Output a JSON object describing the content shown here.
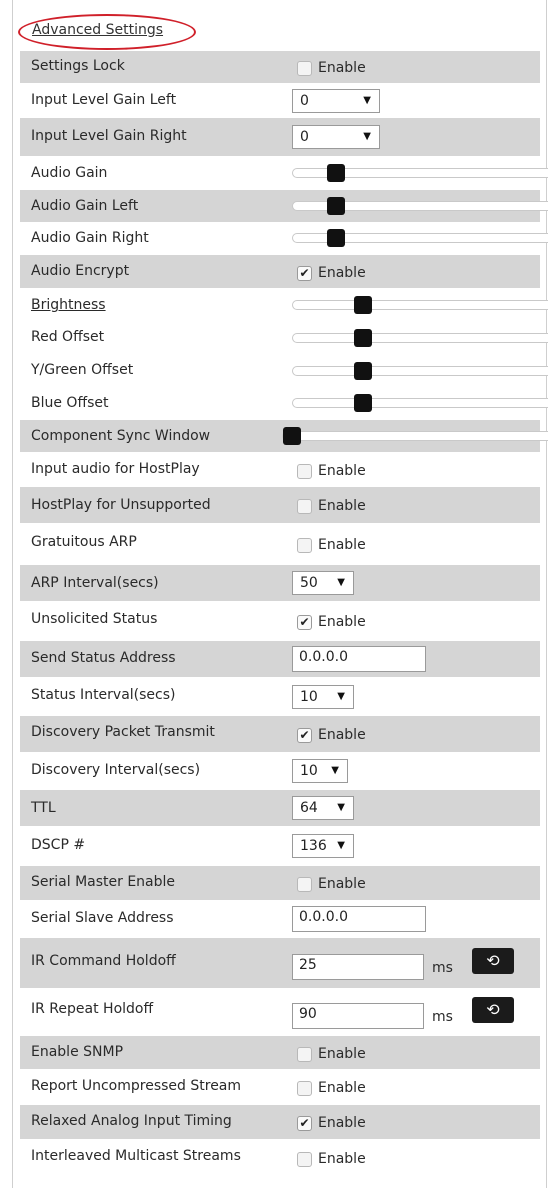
{
  "header": {
    "title": "Advanced Settings"
  },
  "labels": {
    "settings_lock": "Settings Lock",
    "input_gain_left": "Input Level Gain Left",
    "input_gain_right": "Input Level Gain Right",
    "audio_gain": "Audio Gain",
    "audio_gain_left": "Audio Gain Left",
    "audio_gain_right": "Audio Gain Right",
    "audio_encrypt": "Audio Encrypt",
    "brightness": "Brightness",
    "red_offset": "Red Offset",
    "green_offset": "Y/Green Offset",
    "blue_offset": "Blue Offset",
    "component_sync": "Component Sync Window",
    "input_audio_hostplay": "Input audio for HostPlay",
    "hostplay_unsupported": "HostPlay for Unsupported",
    "gratuitous_arp": "Gratuitous ARP",
    "arp_interval": "ARP Interval(secs)",
    "unsolicited_status": "Unsolicited Status",
    "send_status_address": "Send Status Address",
    "status_interval": "Status Interval(secs)",
    "discovery_packet": "Discovery Packet Transmit",
    "discovery_interval": "Discovery Interval(secs)",
    "ttl": "TTL",
    "dscp": "DSCP #",
    "serial_master": "Serial Master Enable",
    "serial_slave_address": "Serial Slave Address",
    "ir_command_holdoff": "IR Command Holdoff",
    "ir_repeat_holdoff": "IR Repeat Holdoff",
    "enable_snmp": "Enable SNMP",
    "report_uncompressed": "Report Uncompressed Stream",
    "relaxed_analog": "Relaxed Analog Input Timing",
    "interleaved_multicast": "Interleaved Multicast Streams"
  },
  "enable_text": "Enable",
  "checkboxes": {
    "settings_lock": false,
    "audio_encrypt": true,
    "input_audio_hostplay": false,
    "hostplay_unsupported": false,
    "gratuitous_arp": false,
    "unsolicited_status": true,
    "discovery_packet": true,
    "serial_master": false,
    "enable_snmp": false,
    "report_uncompressed": false,
    "relaxed_analog": true,
    "interleaved_multicast": false
  },
  "selects": {
    "input_gain_left": "0",
    "input_gain_right": "0",
    "arp_interval": "50",
    "status_interval": "10",
    "discovery_interval": "10",
    "ttl": "64",
    "dscp": "136"
  },
  "inputs": {
    "send_status_address": "0.0.0.0",
    "serial_slave_address": "0.0.0.0",
    "ir_command_holdoff": "25",
    "ir_repeat_holdoff": "90"
  },
  "units": {
    "ms": "ms"
  },
  "sliders": {
    "audio_gain": 0.14,
    "audio_gain_left": 0.14,
    "audio_gain_right": 0.14,
    "brightness": 0.25,
    "red_offset": 0.25,
    "green_offset": 0.25,
    "blue_offset": 0.25,
    "component_sync": 0.0
  },
  "icons": {
    "reset": "reset-arrow-icon",
    "checkmark": "✔",
    "dropdown": "▼"
  },
  "colors": {
    "highlight_ring": "#d0202a",
    "row_shade": "#d5d5d5",
    "knob": "#111111"
  }
}
